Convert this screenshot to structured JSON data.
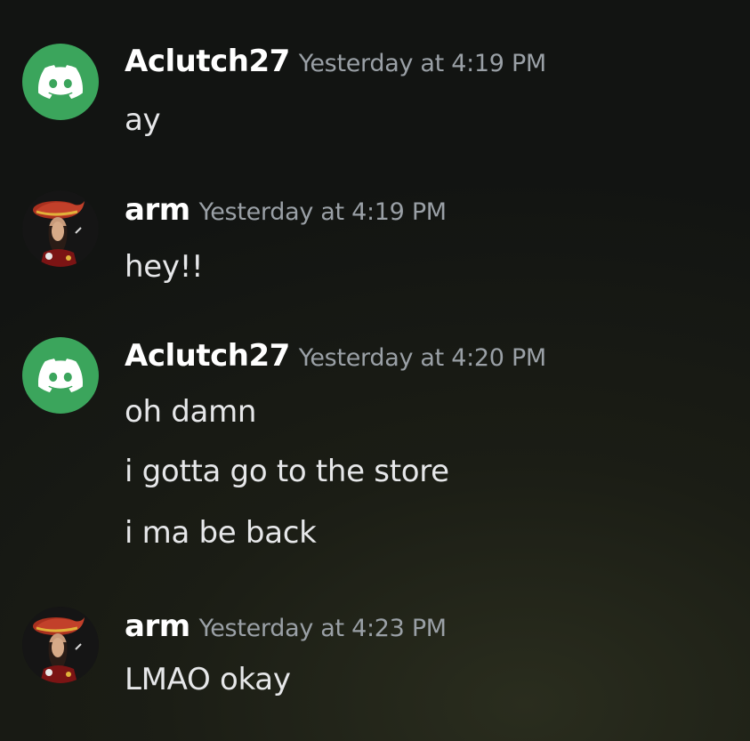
{
  "messages": [
    {
      "author": "Aclutch27",
      "avatar": "discord-logo-icon",
      "avatar_color": "#3ba55c",
      "timestamp": "Yesterday at 4:19 PM",
      "lines": [
        "ay"
      ]
    },
    {
      "author": "arm",
      "avatar": "pirate-avatar",
      "timestamp": "Yesterday at 4:19 PM",
      "lines": [
        "hey!!"
      ]
    },
    {
      "author": "Aclutch27",
      "avatar": "discord-logo-icon",
      "avatar_color": "#3ba55c",
      "timestamp": "Yesterday at 4:20 PM",
      "lines": [
        "oh damn",
        "i gotta go to the store",
        "i ma be back"
      ]
    },
    {
      "author": "arm",
      "avatar": "pirate-avatar",
      "timestamp": "Yesterday at 4:23 PM",
      "lines": [
        "LMAO okay"
      ]
    }
  ]
}
